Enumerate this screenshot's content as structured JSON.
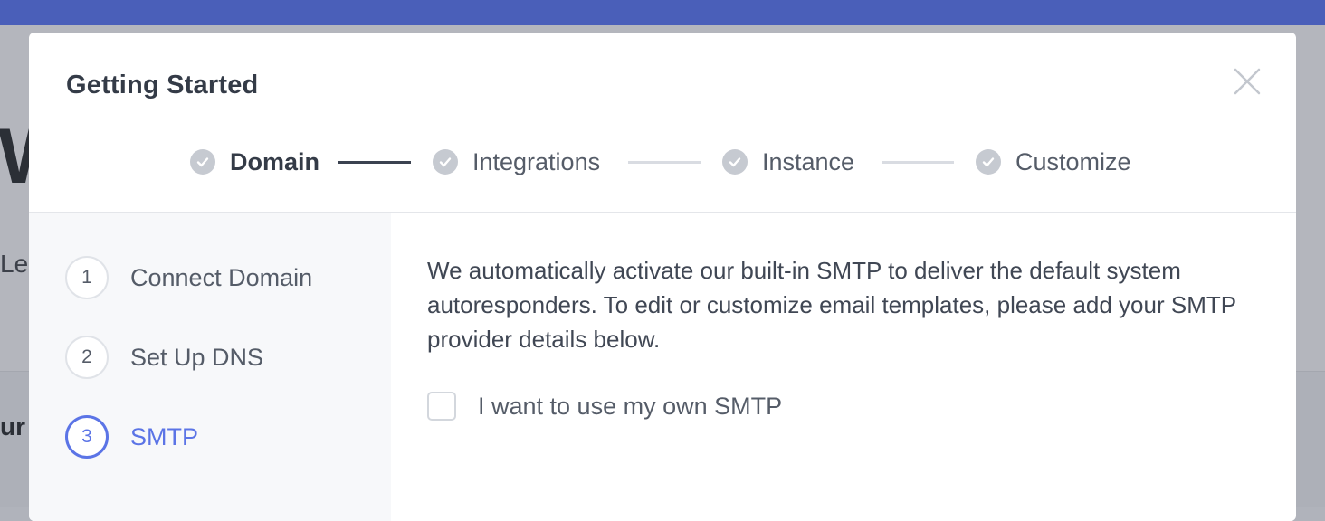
{
  "background": {
    "heading_fragment": "W",
    "sub_fragment": "Le",
    "band_fragment": "ur l"
  },
  "modal": {
    "title": "Getting Started",
    "close_icon": "close-icon"
  },
  "stepper": {
    "steps": [
      {
        "label": "Domain",
        "icon": "check-circle-icon",
        "active": true
      },
      {
        "label": "Integrations",
        "icon": "check-circle-icon",
        "active": false
      },
      {
        "label": "Instance",
        "icon": "check-circle-icon",
        "active": false
      },
      {
        "label": "Customize",
        "icon": "check-circle-icon",
        "active": false
      }
    ]
  },
  "sidebar": {
    "items": [
      {
        "number": "1",
        "label": "Connect Domain",
        "active": false
      },
      {
        "number": "2",
        "label": "Set Up DNS",
        "active": false
      },
      {
        "number": "3",
        "label": "SMTP",
        "active": true
      }
    ]
  },
  "content": {
    "description": "We automatically activate our built-in SMTP to deliver the default system autoresponders. To edit or customize email templates, please add your SMTP provider details below.",
    "own_smtp_checkbox": {
      "label": "I want to use my own SMTP",
      "checked": false
    }
  },
  "colors": {
    "top_bar": "#4a5fb9",
    "accent": "#5b74e6",
    "text_dark": "#343b47",
    "text_muted": "#555c68"
  }
}
